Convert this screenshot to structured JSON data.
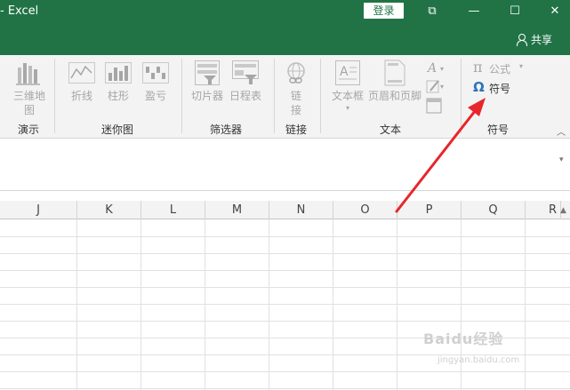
{
  "titlebar": {
    "app_title": "- Excel",
    "login_label": "登录",
    "restore_glyph": "⧉",
    "minimize_glyph": "—",
    "maximize_glyph": "☐",
    "close_glyph": "✕",
    "share_label": "共享"
  },
  "ribbon": {
    "groups": {
      "demo": {
        "label": "演示",
        "items": [
          "三维地",
          "图"
        ]
      },
      "sparkline": {
        "label": "迷你图",
        "items": [
          "折线",
          "柱形",
          "盈亏"
        ]
      },
      "filter": {
        "label": "筛选器",
        "items": [
          "切片器",
          "日程表"
        ]
      },
      "link": {
        "label": "链接",
        "items": [
          "链",
          "接"
        ]
      },
      "text": {
        "label": "文本",
        "items": [
          "文本框",
          "页眉和页脚"
        ]
      },
      "symbol": {
        "label": "符号",
        "formula_label": "公式",
        "symbol_label": "符号",
        "pi_glyph": "π",
        "omega_glyph": "Ω"
      }
    }
  },
  "grid": {
    "columns": [
      "J",
      "K",
      "L",
      "M",
      "N",
      "O",
      "P",
      "Q",
      "R"
    ]
  },
  "watermark": {
    "text": "Baidu经验",
    "sub": "jingyan.baidu.com"
  },
  "colors": {
    "accent": "#217346",
    "arrow": "#e8262a"
  }
}
